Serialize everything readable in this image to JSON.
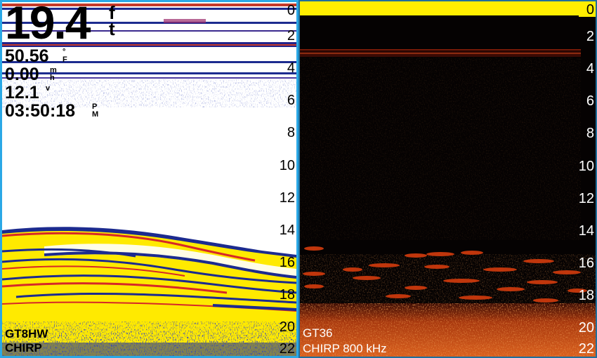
{
  "left_panel": {
    "depth_value": "19.4",
    "depth_unit": [
      "f",
      "t"
    ],
    "readouts": [
      {
        "value": "50.56",
        "unit": [
          "°",
          "F"
        ]
      },
      {
        "value": "0.00",
        "unit": [
          "m",
          "h"
        ]
      },
      {
        "value": "12.1",
        "unit": [
          "",
          "v"
        ]
      },
      {
        "value": "03:50:18",
        "unit": [
          "P",
          "M"
        ]
      }
    ],
    "transducer": "GT8HW",
    "mode": "CHIRP",
    "depth_scale": [
      "0",
      "2",
      "4",
      "6",
      "8",
      "10",
      "12",
      "14",
      "16",
      "18",
      "20",
      "22"
    ]
  },
  "right_panel": {
    "transducer": "GT36",
    "mode": "CHIRP 800 kHz",
    "depth_scale": [
      "0",
      "2",
      "4",
      "6",
      "8",
      "10",
      "12",
      "14",
      "16",
      "18",
      "20",
      "22"
    ]
  },
  "colors": {
    "left_border": "#2aa8e6",
    "right_border": "#1f6f9c",
    "sonar_yellow": "#ffea00",
    "sonar_red": "#d62828",
    "sonar_blue": "#1c2b8f",
    "sonar_orange": "#c2461a",
    "scale_highlight": "#ffee00"
  }
}
